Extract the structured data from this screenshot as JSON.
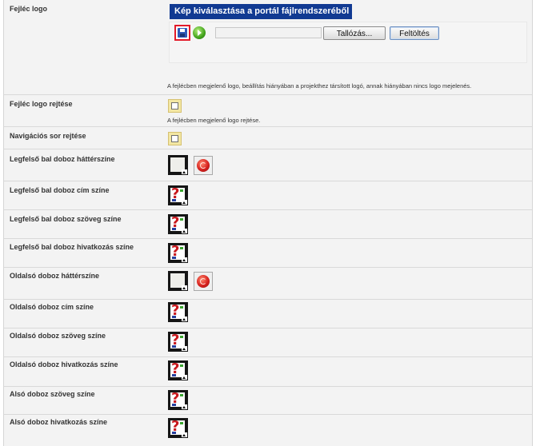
{
  "logo": {
    "label": "Fejléc logo",
    "picker_bar": "Kép kiválasztása a portál fájlrendszeréből",
    "browse_label": "Tallózás...",
    "upload_label": "Feltöltés",
    "description": "A fejlécben megjelenő logo, beállítás hiányában a projekthez társított logó, annak hiányában nincs logo mejelenés."
  },
  "hide_logo": {
    "label": "Fejléc logo rejtése",
    "description": "A fejlécben megjelenő logo rejtése.",
    "checked": false
  },
  "hide_nav": {
    "label": "Navigációs sor rejtése",
    "checked": false
  },
  "color_fields": [
    {
      "label": "Legfelső bal doboz háttérszíne",
      "state": "set",
      "has_reset": true
    },
    {
      "label": "Legfelső bal doboz cím színe",
      "state": "unset",
      "has_reset": false
    },
    {
      "label": "Legfelső bal doboz szöveg színe",
      "state": "unset",
      "has_reset": false
    },
    {
      "label": "Legfelső bal doboz hivatkozás színe",
      "state": "unset",
      "has_reset": false
    },
    {
      "label": "Oldalsó doboz háttérszíne",
      "state": "set",
      "has_reset": true
    },
    {
      "label": "Oldalsó doboz cím színe",
      "state": "unset",
      "has_reset": false
    },
    {
      "label": "Oldalsó doboz szöveg színe",
      "state": "unset",
      "has_reset": false
    },
    {
      "label": "Oldalsó doboz hivatkozás színe",
      "state": "unset",
      "has_reset": false
    },
    {
      "label": "Alsó doboz szöveg színe",
      "state": "unset",
      "has_reset": false
    },
    {
      "label": "Alsó doboz hivatkozás színe",
      "state": "unset",
      "has_reset": false
    }
  ],
  "colors": {
    "picker_bar_bg": "#113a92",
    "checkbox_bg": "#f3e7a3",
    "panel_bg": "#f3f3f3"
  },
  "icons": {
    "save": "save-icon",
    "go": "go-icon",
    "color_picker": "color-picker-icon",
    "unset_color": "question-mark-icon",
    "reset": "reset-icon"
  }
}
